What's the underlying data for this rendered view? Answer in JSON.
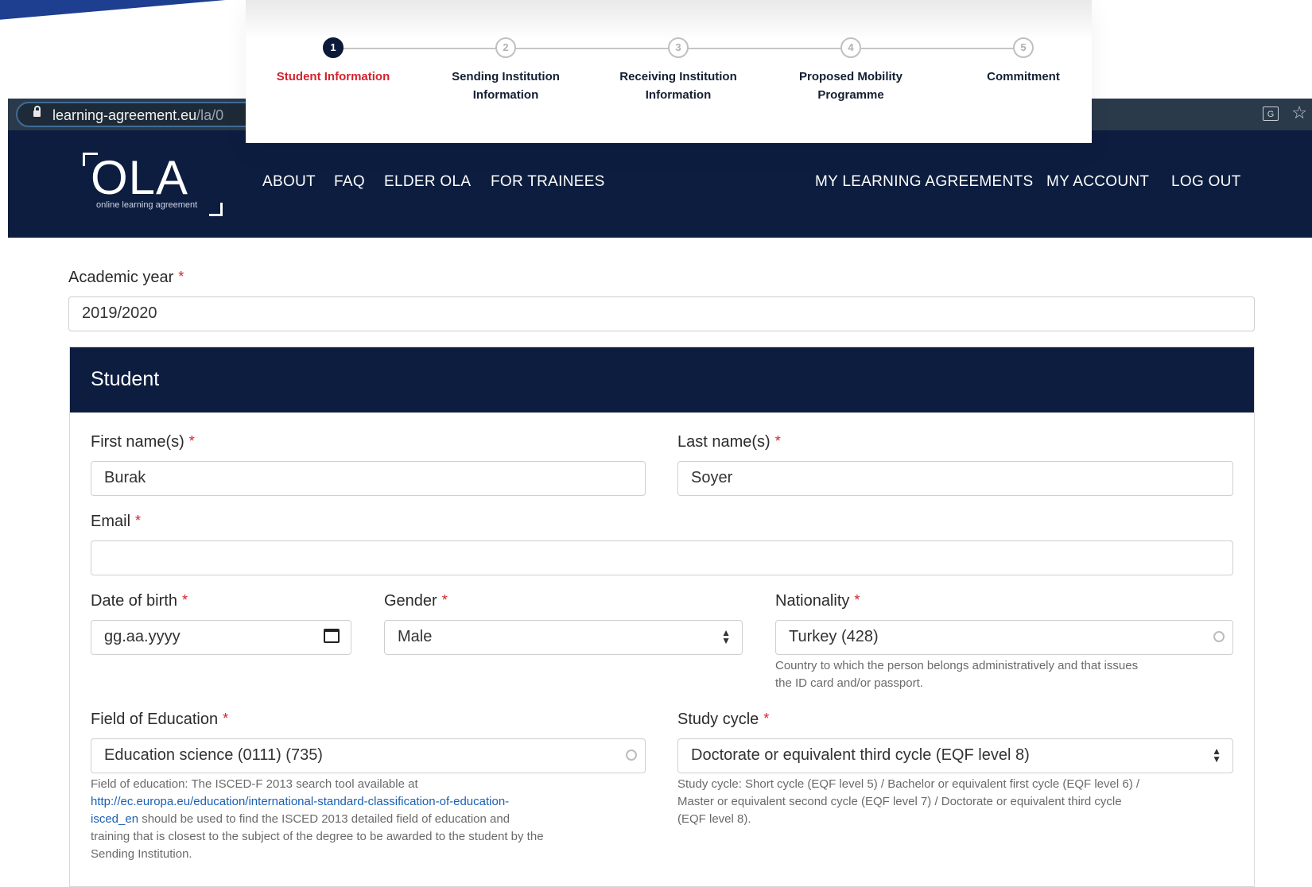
{
  "browser": {
    "url_host": "learning-agreement.eu",
    "url_path": "/la/0"
  },
  "stepper": {
    "steps": [
      {
        "number": "1",
        "label_line1": "Student Information",
        "label_line2": ""
      },
      {
        "number": "2",
        "label_line1": "Sending Institution",
        "label_line2": "Information"
      },
      {
        "number": "3",
        "label_line1": "Receiving Institution",
        "label_line2": "Information"
      },
      {
        "number": "4",
        "label_line1": "Proposed Mobility",
        "label_line2": "Programme"
      },
      {
        "number": "5",
        "label_line1": "Commitment",
        "label_line2": ""
      }
    ],
    "active_step": 1
  },
  "nav": {
    "logo_text": "OLA",
    "logo_sub": "online learning agreement",
    "left_links": [
      "ABOUT",
      "FAQ",
      "ELDER OLA",
      "FOR TRAINEES"
    ],
    "right_links": [
      "MY LEARNING AGREEMENTS",
      "MY ACCOUNT",
      "LOG OUT"
    ]
  },
  "form": {
    "required_mark": "*",
    "academic_year": {
      "label": "Academic year",
      "value": "2019/2020"
    },
    "student": {
      "title": "Student",
      "first_name": {
        "label": "First name(s)",
        "value": "Burak"
      },
      "last_name": {
        "label": "Last name(s)",
        "value": "Soyer"
      },
      "email": {
        "label": "Email",
        "value": ""
      },
      "date_of_birth": {
        "label": "Date of birth",
        "placeholder": "gg.aa.yyyy"
      },
      "gender": {
        "label": "Gender",
        "value": "Male"
      },
      "nationality": {
        "label": "Nationality",
        "value": "Turkey (428)",
        "help_line1": "Country to which the person belongs administratively and that issues",
        "help_line2": "the ID card and/or passport."
      },
      "field_of_education": {
        "label": "Field of Education",
        "value": "Education science (0111) (735)",
        "help_line1": "Field of education: The ISCED-F 2013 search tool available at",
        "help_link_line1": "http://ec.europa.eu/education/international-standard-classification-of-education-",
        "help_link_line2": "isced_en",
        "help_line3_rest": " should be used to find the ISCED 2013 detailed field of education and",
        "help_line4": "training that is closest to the subject of the degree to be awarded to the student by the",
        "help_line5": "Sending Institution."
      },
      "study_cycle": {
        "label": "Study cycle",
        "value": "Doctorate or equivalent third cycle (EQF level 8)",
        "help_line1": "Study cycle: Short cycle (EQF level 5) / Bachelor or equivalent first cycle (EQF level 6) /",
        "help_line2": "Master or equivalent second cycle (EQF level 7) / Doctorate or equivalent third cycle",
        "help_line3": "(EQF level 8)."
      }
    }
  },
  "icons": {
    "lock": "lock-icon",
    "translate": "translate-icon",
    "bookmark": "star-icon",
    "calendar": "calendar-icon",
    "select": "updown-arrows-icon",
    "autocomplete": "circle-icon"
  },
  "colors": {
    "navy": "#0c1d3f",
    "required_red": "#d2222d",
    "link_blue": "#1a5fb4"
  }
}
